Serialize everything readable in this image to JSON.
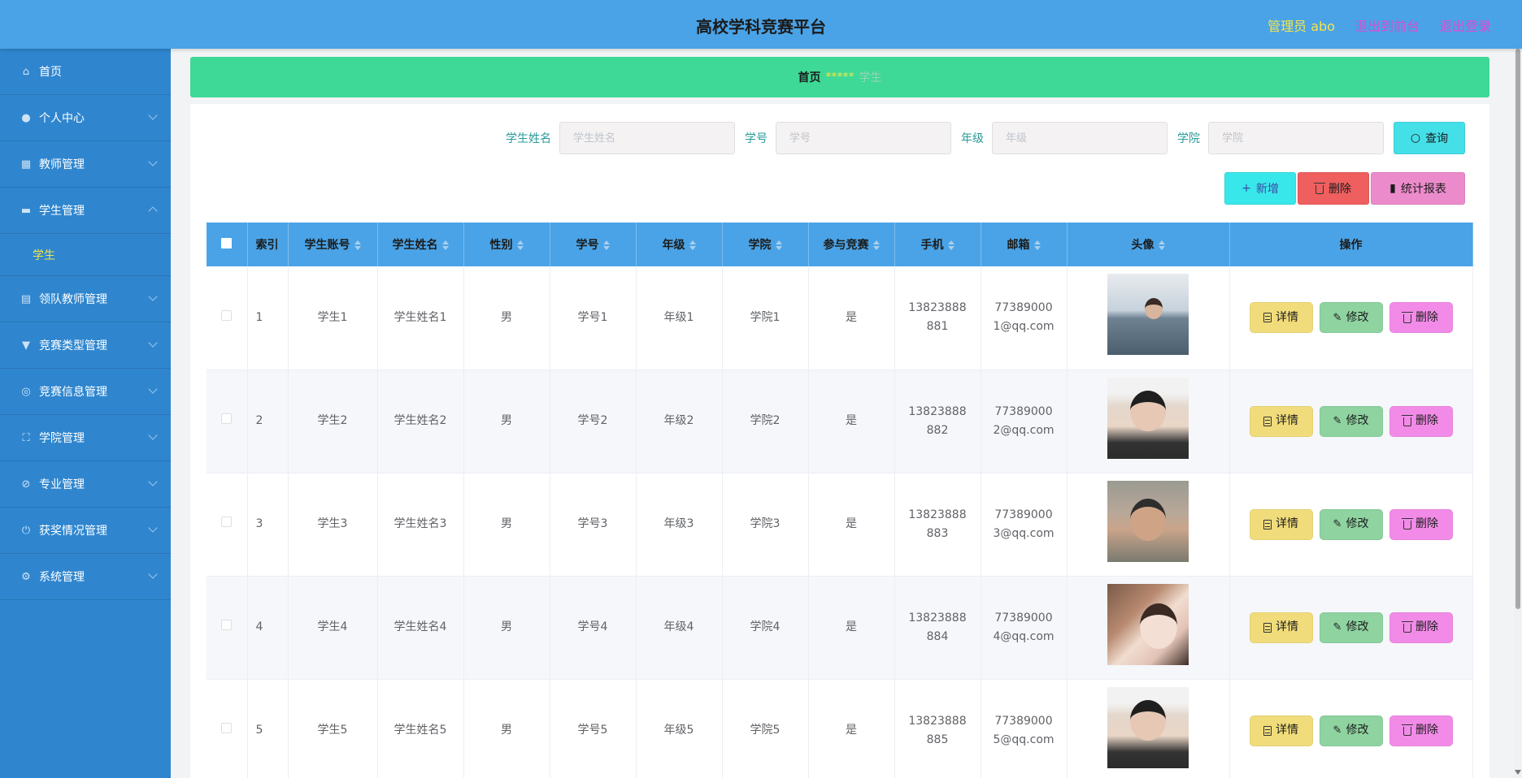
{
  "header": {
    "title": "高校学科竞赛平台",
    "admin": "管理员 abo",
    "back_front": "退出到前台",
    "logout": "退出登录"
  },
  "sidebar": {
    "items": [
      {
        "label": "首页",
        "icon": "home-icon"
      },
      {
        "label": "个人中心",
        "icon": "user-icon"
      },
      {
        "label": "教师管理",
        "icon": "grid-icon"
      },
      {
        "label": "学生管理",
        "icon": "briefcase-icon",
        "expanded": true
      },
      {
        "label": "领队教师管理",
        "icon": "clipboard-icon"
      },
      {
        "label": "竞赛类型管理",
        "icon": "trophy-icon"
      },
      {
        "label": "竞赛信息管理",
        "icon": "compass-icon"
      },
      {
        "label": "学院管理",
        "icon": "fullscreen-icon"
      },
      {
        "label": "专业管理",
        "icon": "mute-icon"
      },
      {
        "label": "获奖情况管理",
        "icon": "power-icon"
      },
      {
        "label": "系统管理",
        "icon": "settings-icon"
      }
    ],
    "sub_item": "学生"
  },
  "breadcrumb": {
    "home": "首页",
    "separator": "*****",
    "current": "学生"
  },
  "search": {
    "name_label": "学生姓名",
    "name_placeholder": "学生姓名",
    "number_label": "学号",
    "number_placeholder": "学号",
    "grade_label": "年级",
    "grade_placeholder": "年级",
    "college_label": "学院",
    "college_placeholder": "学院",
    "query_button": "查询"
  },
  "actions": {
    "add": "新增",
    "delete": "删除",
    "report": "统计报表"
  },
  "table": {
    "columns": [
      "索引",
      "学生账号",
      "学生姓名",
      "性别",
      "学号",
      "年级",
      "学院",
      "参与竞赛",
      "手机",
      "邮箱",
      "头像",
      "操作"
    ],
    "rows": [
      {
        "index": "1",
        "account": "学生1",
        "name": "学生姓名1",
        "gender": "男",
        "number": "学号1",
        "grade": "年级1",
        "college": "学院1",
        "joined": "是",
        "phone": "13823888881",
        "email": "773890001@qq.com"
      },
      {
        "index": "2",
        "account": "学生2",
        "name": "学生姓名2",
        "gender": "男",
        "number": "学号2",
        "grade": "年级2",
        "college": "学院2",
        "joined": "是",
        "phone": "13823888882",
        "email": "773890002@qq.com"
      },
      {
        "index": "3",
        "account": "学生3",
        "name": "学生姓名3",
        "gender": "男",
        "number": "学号3",
        "grade": "年级3",
        "college": "学院3",
        "joined": "是",
        "phone": "13823888883",
        "email": "773890003@qq.com"
      },
      {
        "index": "4",
        "account": "学生4",
        "name": "学生姓名4",
        "gender": "男",
        "number": "学号4",
        "grade": "年级4",
        "college": "学院4",
        "joined": "是",
        "phone": "13823888884",
        "email": "773890004@qq.com"
      },
      {
        "index": "5",
        "account": "学生5",
        "name": "学生姓名5",
        "gender": "男",
        "number": "学号5",
        "grade": "年级5",
        "college": "学院5",
        "joined": "是",
        "phone": "13823888885",
        "email": "773890005@qq.com"
      }
    ],
    "row_actions": {
      "detail": "详情",
      "edit": "修改",
      "delete": "删除"
    }
  },
  "colors": {
    "header": "#4aa3e6",
    "sidebar": "#2f86cf",
    "breadcrumb": "#3ed996",
    "highlight": "#f5e44a"
  }
}
